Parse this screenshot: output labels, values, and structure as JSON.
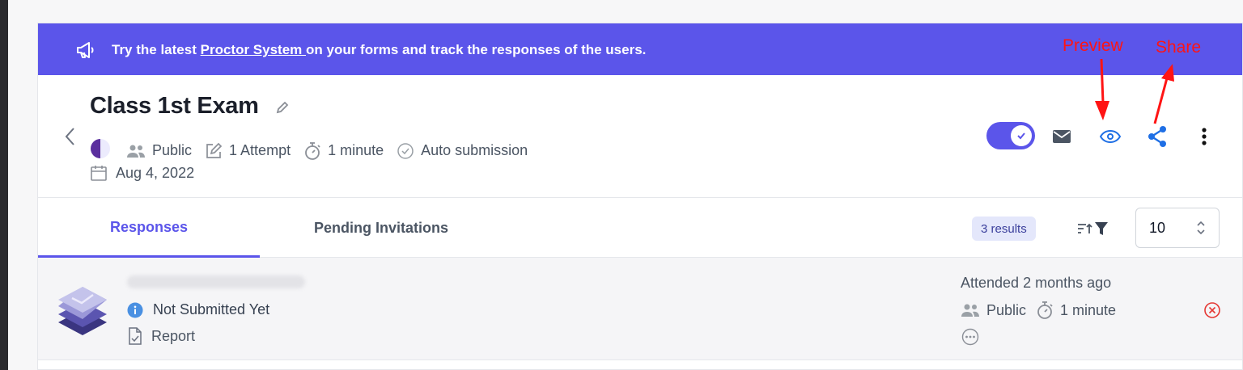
{
  "banner": {
    "prefix": "Try the latest ",
    "link": "Proctor System ",
    "suffix": "on your forms and track the responses of the users."
  },
  "annotations": {
    "preview": "Preview",
    "share": "Share"
  },
  "exam": {
    "title": "Class 1st Exam",
    "visibility": "Public",
    "attempts": "1 Attempt",
    "duration": "1 minute",
    "submission": "Auto submission",
    "date": "Aug 4, 2022",
    "published": true
  },
  "tabs": [
    {
      "label": "Responses"
    },
    {
      "label": "Pending Invitations"
    }
  ],
  "results_badge": "3 results",
  "per_page": "10",
  "responses": [
    {
      "status": "Not Submitted Yet",
      "report": "Report",
      "attended": "Attended 2 months ago",
      "visibility": "Public",
      "duration": "1 minute"
    }
  ],
  "colors": {
    "accent": "#5b55ea",
    "link_blue": "#1f6fe5",
    "annotation": "#ff1414",
    "remove": "#e53935"
  }
}
